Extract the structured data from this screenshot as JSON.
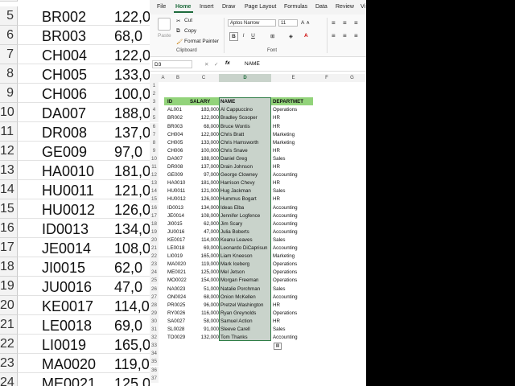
{
  "ribbon": {
    "tabs": [
      "File",
      "Home",
      "Insert",
      "Draw",
      "Page Layout",
      "Formulas",
      "Data",
      "Review",
      "Vi"
    ],
    "active_tab": "Home",
    "paste_label": "Paste",
    "cut_label": "Cut",
    "copy_label": "Copy",
    "format_painter_label": "Format Painter",
    "clipboard_group": "Clipboard",
    "font_name": "Aptos Narrow",
    "font_size": "11",
    "font_group": "Font",
    "bold": "B",
    "italic": "I",
    "underline": "U"
  },
  "formula_bar": {
    "name_box": "D3",
    "fx": "fx",
    "content": "NAME"
  },
  "columns": [
    "A",
    "B",
    "C",
    "D",
    "E",
    "F",
    "G"
  ],
  "headers": {
    "id": "ID",
    "salary": "SALARY",
    "name": "NAME",
    "dept": "DEPARTMET"
  },
  "rows": [
    {
      "id": "AL001",
      "salary": "183,000",
      "name": "Al Cappuccino",
      "dept": "Operations"
    },
    {
      "id": "BR002",
      "salary": "122,000",
      "name": "Bradley Scooper",
      "dept": "HR"
    },
    {
      "id": "BR003",
      "salary": "68,000",
      "name": "Bruce Wontis",
      "dept": "HR"
    },
    {
      "id": "CH004",
      "salary": "122,000",
      "name": "Chris Bratt",
      "dept": "Marketing"
    },
    {
      "id": "CH005",
      "salary": "133,000",
      "name": "Chris Hamsworth",
      "dept": "Marketing"
    },
    {
      "id": "CH006",
      "salary": "100,000",
      "name": "Chris Snave",
      "dept": "HR"
    },
    {
      "id": "DA007",
      "salary": "188,000",
      "name": "Daniel Greg",
      "dept": "Sales"
    },
    {
      "id": "DR008",
      "salary": "137,000",
      "name": "Drain Johnson",
      "dept": "HR"
    },
    {
      "id": "GE009",
      "salary": "97,000",
      "name": "George Clowney",
      "dept": "Accounting"
    },
    {
      "id": "HA0010",
      "salary": "181,000",
      "name": "Harrison Chevy",
      "dept": "HR"
    },
    {
      "id": "HU0011",
      "salary": "121,000",
      "name": "Hug Jackman",
      "dept": "Sales"
    },
    {
      "id": "HU0012",
      "salary": "126,000",
      "name": "Hummus Bogart",
      "dept": "HR"
    },
    {
      "id": "ID0013",
      "salary": "134,000",
      "name": "Ideas Elba",
      "dept": "Accounting"
    },
    {
      "id": "JE0014",
      "salary": "108,000",
      "name": "Jennifer Logfence",
      "dept": "Accounting"
    },
    {
      "id": "JI0015",
      "salary": "62,000",
      "name": "Jim Scary",
      "dept": "Accounting"
    },
    {
      "id": "JU0016",
      "salary": "47,000",
      "name": "Julia Boberts",
      "dept": "Accounting"
    },
    {
      "id": "KE0017",
      "salary": "114,000",
      "name": "Keanu Leaves",
      "dept": "Sales"
    },
    {
      "id": "LE0018",
      "salary": "69,000",
      "name": "Leonardo DiCaprisun",
      "dept": "Accounting"
    },
    {
      "id": "LI0019",
      "salary": "165,000",
      "name": "Liam Kneeson",
      "dept": "Marketing"
    },
    {
      "id": "MA0020",
      "salary": "119,000",
      "name": "Mark Iceberg",
      "dept": "Operations"
    },
    {
      "id": "ME0021",
      "salary": "125,000",
      "name": "Mel Jetson",
      "dept": "Operations"
    },
    {
      "id": "MO0022",
      "salary": "154,000",
      "name": "Morgan Freeman",
      "dept": "Operations"
    },
    {
      "id": "NA0023",
      "salary": "51,000",
      "name": "Natalie Porchman",
      "dept": "Sales"
    },
    {
      "id": "ON0024",
      "salary": "68,000",
      "name": "Onion McKellen",
      "dept": "Accounting"
    },
    {
      "id": "PR0025",
      "salary": "96,000",
      "name": "Pretzel Washington",
      "dept": "HR"
    },
    {
      "id": "RY0026",
      "salary": "116,000",
      "name": "Ryan Greynolds",
      "dept": "Operations"
    },
    {
      "id": "SA0027",
      "salary": "58,000",
      "name": "Samuel Action",
      "dept": "HR"
    },
    {
      "id": "SL0028",
      "salary": "91,000",
      "name": "Sleeve Carell",
      "dept": "Sales"
    },
    {
      "id": "TO0029",
      "salary": "132,000",
      "name": "Tom Thanks",
      "dept": "Accounting"
    }
  ],
  "background_zoom": {
    "rows": [
      {
        "n": "5",
        "id": "BR002",
        "salary": "122,0"
      },
      {
        "n": "6",
        "id": "BR003",
        "salary": "68,0"
      },
      {
        "n": "7",
        "id": "CH004",
        "salary": "122,0"
      },
      {
        "n": "8",
        "id": "CH005",
        "salary": "133,0"
      },
      {
        "n": "9",
        "id": "CH006",
        "salary": "100,0"
      },
      {
        "n": "10",
        "id": "DA007",
        "salary": "188,0"
      },
      {
        "n": "11",
        "id": "DR008",
        "salary": "137,0"
      },
      {
        "n": "12",
        "id": "GE009",
        "salary": "97,0"
      },
      {
        "n": "13",
        "id": "HA0010",
        "salary": "181,0"
      },
      {
        "n": "14",
        "id": "HU0011",
        "salary": "121,0"
      },
      {
        "n": "15",
        "id": "HU0012",
        "salary": "126,0"
      },
      {
        "n": "16",
        "id": "ID0013",
        "salary": "134,0"
      },
      {
        "n": "17",
        "id": "JE0014",
        "salary": "108,0"
      },
      {
        "n": "18",
        "id": "JI0015",
        "salary": "62,0"
      },
      {
        "n": "19",
        "id": "JU0016",
        "salary": "47,0"
      },
      {
        "n": "20",
        "id": "KE0017",
        "salary": "114,0"
      },
      {
        "n": "21",
        "id": "LE0018",
        "salary": "69,0"
      },
      {
        "n": "22",
        "id": "LI0019",
        "salary": "165,0"
      },
      {
        "n": "23",
        "id": "MA0020",
        "salary": "119,0"
      },
      {
        "n": "24",
        "id": "ME0021",
        "salary": "125,0"
      }
    ]
  }
}
